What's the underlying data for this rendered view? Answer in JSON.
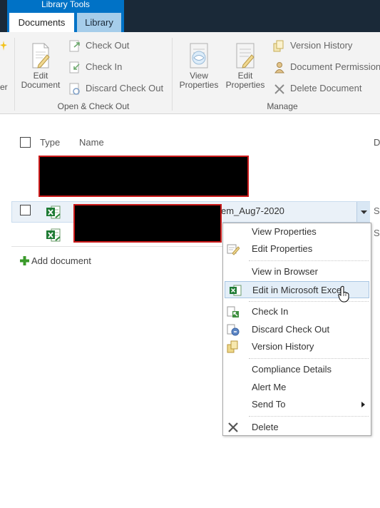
{
  "ribbon_header": {
    "context_group": "Library Tools",
    "tabs": [
      {
        "label": "Documents",
        "active": true
      },
      {
        "label": "Library",
        "active": false
      }
    ]
  },
  "ribbon": {
    "cut_left_label": "er",
    "open_checkout": {
      "group_label": "Open & Check Out",
      "edit_document_line1": "Edit",
      "edit_document_line2": "Document",
      "check_out": "Check Out",
      "check_in": "Check In",
      "discard_check_out": "Discard Check Out"
    },
    "manage": {
      "group_label": "Manage",
      "view_properties_line1": "View",
      "view_properties_line2": "Properties",
      "edit_properties_line1": "Edit",
      "edit_properties_line2": "Properties",
      "version_history": "Version History",
      "document_permissions": "Document Permissions",
      "delete_document": "Delete Document"
    }
  },
  "list": {
    "columns": {
      "type": "Type",
      "name": "Name",
      "cut_right": "D"
    },
    "rows": [
      {
        "name_suffix": "em_Aug7-2020",
        "cut_col": "S"
      },
      {
        "cut_col": "S"
      }
    ],
    "add_document": "Add document"
  },
  "context_menu": {
    "items": [
      {
        "label": "View Properties"
      },
      {
        "label": "Edit Properties"
      },
      {
        "label": "View in Browser"
      },
      {
        "label": "Edit in Microsoft Excel",
        "highlighted": true
      },
      {
        "label": "Check In"
      },
      {
        "label": "Discard Check Out"
      },
      {
        "label": "Version History"
      },
      {
        "label": "Compliance Details"
      },
      {
        "label": "Alert Me"
      },
      {
        "label": "Send To",
        "has_submenu": true
      },
      {
        "label": "Delete"
      }
    ]
  },
  "colors": {
    "top_bar": "#1a2938",
    "context_group": "#0072c6",
    "library_tab": "#a6cdea",
    "row_highlight": "#eaf1f8",
    "redaction_border": "#cc1a1a",
    "excel_green": "#1e7b34",
    "add_plus": "#3a9a2a"
  },
  "icons": {
    "ribbon": [
      "edit-document-icon",
      "check-out-icon",
      "check-in-icon",
      "discard-check-out-icon",
      "view-properties-icon",
      "edit-properties-icon",
      "version-history-icon",
      "document-permissions-icon",
      "delete-document-icon"
    ],
    "list": [
      "excel-file-icon",
      "add-plus-icon",
      "dropdown-arrow-icon"
    ],
    "menu": [
      "edit-properties-icon",
      "excel-icon",
      "check-in-icon",
      "discard-check-out-icon",
      "version-history-icon",
      "delete-x-icon",
      "submenu-arrow-icon",
      "hand-cursor-icon"
    ]
  }
}
